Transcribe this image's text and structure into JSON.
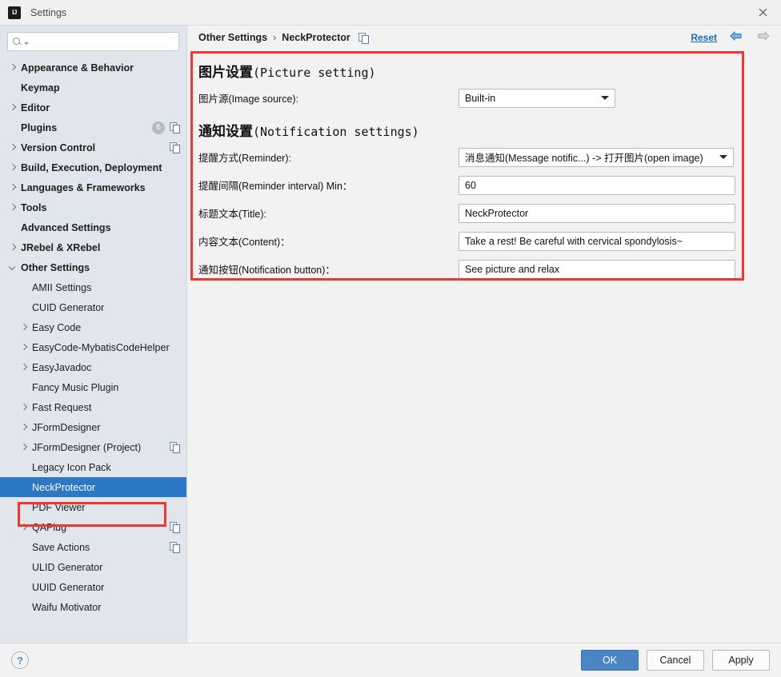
{
  "window": {
    "title": "Settings",
    "app_icon": "intellij-idea-icon",
    "close_icon": "close-icon"
  },
  "search": {
    "value": "",
    "placeholder": "",
    "icon": "search-icon"
  },
  "sidebar": {
    "items": [
      {
        "label": "Appearance & Behavior",
        "arrow": "right",
        "level": "top"
      },
      {
        "label": "Keymap",
        "arrow": "none",
        "level": "top"
      },
      {
        "label": "Editor",
        "arrow": "right",
        "level": "top"
      },
      {
        "label": "Plugins",
        "arrow": "none",
        "level": "top",
        "badge": "6",
        "copy_icon": true
      },
      {
        "label": "Version Control",
        "arrow": "right",
        "level": "top",
        "copy_icon": true
      },
      {
        "label": "Build, Execution, Deployment",
        "arrow": "right",
        "level": "top"
      },
      {
        "label": "Languages & Frameworks",
        "arrow": "right",
        "level": "top"
      },
      {
        "label": "Tools",
        "arrow": "right",
        "level": "top"
      },
      {
        "label": "Advanced Settings",
        "arrow": "none",
        "level": "top"
      },
      {
        "label": "JRebel & XRebel",
        "arrow": "right",
        "level": "top"
      },
      {
        "label": "Other Settings",
        "arrow": "down",
        "level": "top"
      },
      {
        "label": "AMII Settings",
        "arrow": "none",
        "level": "child"
      },
      {
        "label": "CUID Generator",
        "arrow": "none",
        "level": "child"
      },
      {
        "label": "Easy Code",
        "arrow": "right",
        "level": "child"
      },
      {
        "label": "EasyCode-MybatisCodeHelper",
        "arrow": "right",
        "level": "child"
      },
      {
        "label": "EasyJavadoc",
        "arrow": "right",
        "level": "child"
      },
      {
        "label": "Fancy Music Plugin",
        "arrow": "none",
        "level": "child"
      },
      {
        "label": "Fast Request",
        "arrow": "right",
        "level": "child"
      },
      {
        "label": "JFormDesigner",
        "arrow": "right",
        "level": "child"
      },
      {
        "label": "JFormDesigner (Project)",
        "arrow": "right",
        "level": "child",
        "copy_icon": true
      },
      {
        "label": "Legacy Icon Pack",
        "arrow": "none",
        "level": "child"
      },
      {
        "label": "NeckProtector",
        "arrow": "none",
        "level": "child",
        "selected": true
      },
      {
        "label": "PDF Viewer",
        "arrow": "none",
        "level": "child"
      },
      {
        "label": "QAPlug",
        "arrow": "right",
        "level": "child",
        "copy_icon": true
      },
      {
        "label": "Save Actions",
        "arrow": "none",
        "level": "child",
        "copy_icon": true
      },
      {
        "label": "ULID Generator",
        "arrow": "none",
        "level": "child"
      },
      {
        "label": "UUID Generator",
        "arrow": "none",
        "level": "child"
      },
      {
        "label": "Waifu Motivator",
        "arrow": "none",
        "level": "child"
      }
    ]
  },
  "breadcrumb": {
    "parent": "Other Settings",
    "separator": "›",
    "current": "NeckProtector",
    "copy_icon": "copy-icon",
    "reset_label": "Reset",
    "back_icon": "arrow-left-icon",
    "forward_icon": "arrow-right-icon"
  },
  "form": {
    "picture_section": {
      "title_cn": "图片设置",
      "title_en": "(Picture setting)",
      "image_source": {
        "label": "图片源(Image source):",
        "value": "Built-in"
      }
    },
    "notification_section": {
      "title_cn": "通知设置",
      "title_en": "(Notification settings)",
      "reminder": {
        "label": "提醒方式(Reminder):",
        "value": "消息通知(Message notific...) -> 打开图片(open image)"
      },
      "interval": {
        "label": "提醒间隔(Reminder interval) Min：",
        "value": "60"
      },
      "title_field": {
        "label": "标题文本(Title):",
        "value": "NeckProtector"
      },
      "content_field": {
        "label": "内容文本(Content)：",
        "value": "Take a rest! Be careful with cervical spondylosis~"
      },
      "button_field": {
        "label": "通知按钮(Notification button)：",
        "value": "See picture and relax"
      }
    }
  },
  "footer": {
    "help_icon": "help-icon",
    "help_glyph": "?",
    "ok_label": "OK",
    "cancel_label": "Cancel",
    "apply_label": "Apply"
  },
  "colors": {
    "accent_blue": "#2c78c4",
    "link_blue": "#1a69c4",
    "annotation_red": "#f2352e",
    "sidebar_bg": "#e1e6ec",
    "content_bg": "#f2f2f2",
    "primary_button": "#4a86c5"
  }
}
